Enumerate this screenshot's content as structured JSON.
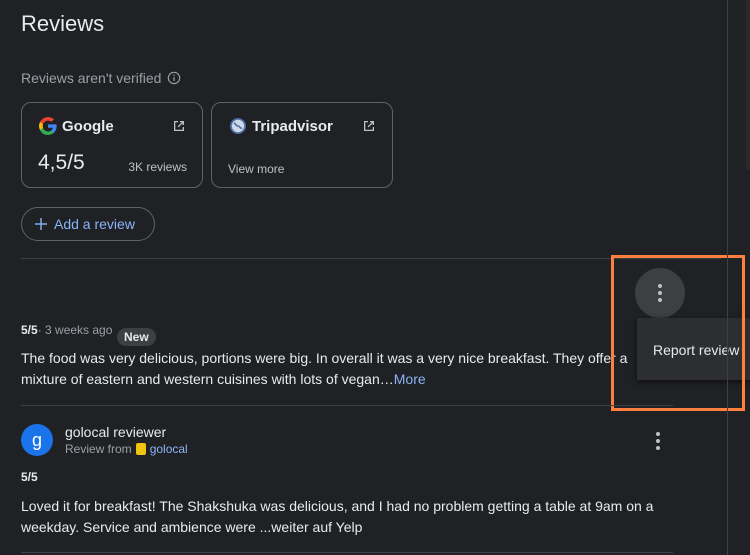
{
  "panel": {
    "title": "Reviews",
    "unverified_note": "Reviews aren't verified"
  },
  "sources": [
    {
      "name": "Google",
      "rating": "4,5/5",
      "count": "3K reviews",
      "icon": "google-icon"
    },
    {
      "name": "Tripadvisor",
      "link": "View more",
      "icon": "tripadvisor-icon"
    }
  ],
  "add_review_label": "Add a review",
  "review1": {
    "score": "5/5",
    "time": " · 3 weeks ago",
    "badge": "New",
    "text": "The food was very delicious, portions were big. In overall it was a very nice breakfast. They offer a mixture of eastern and western cuisines with lots of vegan…",
    "more": "More"
  },
  "menu": {
    "report_label": "Report review"
  },
  "review2": {
    "avatar_letter": "g",
    "author": "golocal reviewer",
    "from_label": "Review from",
    "source": "golocal",
    "score": "5/5",
    "text": "Loved it for breakfast! The Shakshuka was delicious, and I had no problem getting a table at 9am on a weekday. Service and ambience were ...weiter auf Yelp"
  },
  "colors": {
    "accent": "#8ab4f8",
    "highlight": "#ff7f3f",
    "background": "#202124"
  }
}
